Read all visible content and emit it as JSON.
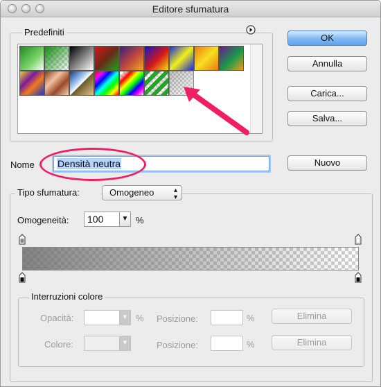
{
  "window": {
    "title": "Editore sfumatura"
  },
  "presets": {
    "group_label": "Predefiniti",
    "menu_icon": "circle-right-arrow-icon",
    "swatches": [
      {
        "name": "swatch-green-white"
      },
      {
        "name": "swatch-green-transparent"
      },
      {
        "name": "swatch-black-white"
      },
      {
        "name": "swatch-red-green"
      },
      {
        "name": "swatch-violet-orange"
      },
      {
        "name": "swatch-blue-red-yellow"
      },
      {
        "name": "swatch-blue-yellow-blue"
      },
      {
        "name": "swatch-orange-yellow-orange"
      },
      {
        "name": "swatch-violet-green-orange"
      },
      {
        "name": "swatch-yellow-violet-orange-blue"
      },
      {
        "name": "swatch-copper"
      },
      {
        "name": "swatch-chrome"
      },
      {
        "name": "swatch-spectrum"
      },
      {
        "name": "swatch-transparent-rainbow"
      },
      {
        "name": "swatch-transparent-stripes"
      },
      {
        "name": "swatch-neutral-density"
      }
    ]
  },
  "buttons": {
    "ok": "OK",
    "cancel": "Annulla",
    "load": "Carica...",
    "save": "Salva...",
    "new": "Nuovo"
  },
  "name": {
    "label": "Nome",
    "value": "Densità neutra"
  },
  "gradient": {
    "type_label": "Tipo sfumatura:",
    "type_value": "Omogeneo",
    "smoothness_label": "Omogeneità:",
    "smoothness_value": "100",
    "smoothness_unit": "%"
  },
  "color_stops": {
    "group_label": "Interruzioni colore",
    "opacity_label": "Opacità:",
    "opacity_unit": "%",
    "color_label": "Colore:",
    "position_label": "Posizione:",
    "position_unit": "%",
    "delete_label": "Elimina"
  },
  "colors": {
    "accent": "#5ea3ef",
    "annotation": "#ef1f62"
  }
}
